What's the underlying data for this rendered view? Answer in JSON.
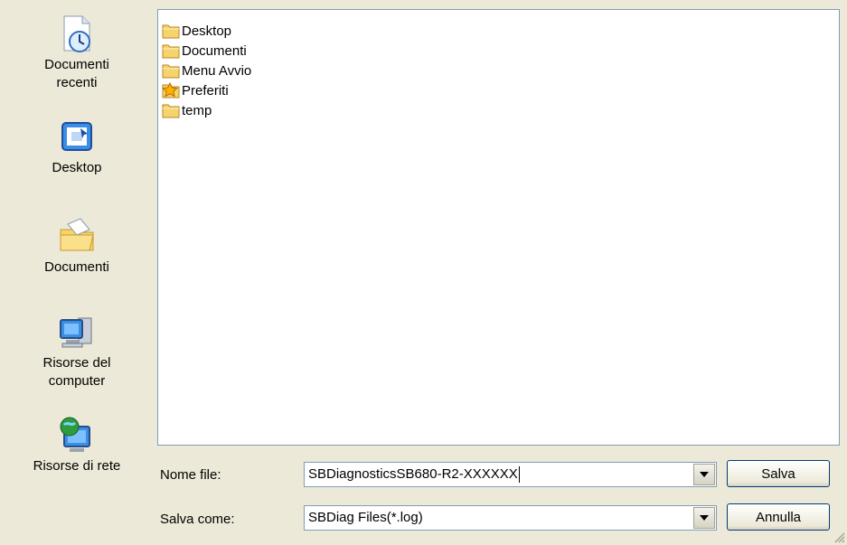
{
  "places": [
    {
      "label_line1": "Documenti",
      "label_line2": "recenti",
      "icon": "recent-documents-icon"
    },
    {
      "label_line1": "Desktop",
      "label_line2": "",
      "icon": "desktop-icon"
    },
    {
      "label_line1": "Documenti",
      "label_line2": "",
      "icon": "my-documents-icon"
    },
    {
      "label_line1": "Risorse del",
      "label_line2": "computer",
      "icon": "my-computer-icon"
    },
    {
      "label_line1": "Risorse di rete",
      "label_line2": "",
      "icon": "network-icon"
    }
  ],
  "files": [
    {
      "name": "Desktop",
      "icon": "folder-icon"
    },
    {
      "name": "Documenti",
      "icon": "folder-icon"
    },
    {
      "name": "Menu Avvio",
      "icon": "folder-icon"
    },
    {
      "name": "Preferiti",
      "icon": "star-folder-icon"
    },
    {
      "name": "temp",
      "icon": "folder-icon"
    }
  ],
  "filename": {
    "label": "Nome file:",
    "value": "SBDiagnosticsSB680-R2-XXXXXX"
  },
  "filetype": {
    "label": "Salva come:",
    "value": "SBDiag Files(*.log)"
  },
  "buttons": {
    "save": "Salva",
    "cancel": "Annulla"
  },
  "colors": {
    "field_border": "#7f9db9",
    "dialog_bg": "#ece9d8",
    "button_border": "#003c74"
  }
}
